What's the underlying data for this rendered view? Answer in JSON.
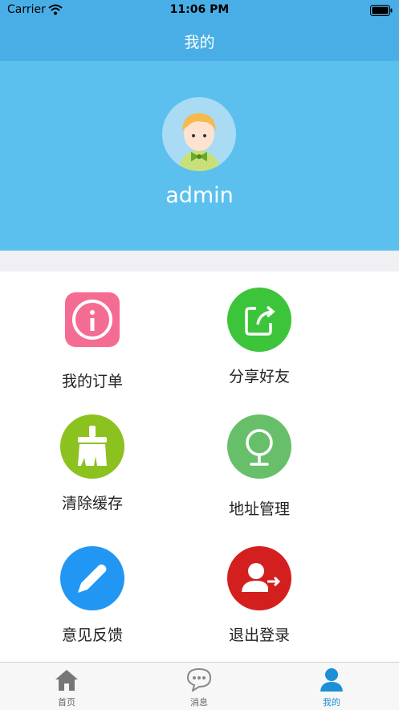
{
  "status_bar": {
    "carrier": "Carrier",
    "time": "11:06 PM"
  },
  "nav": {
    "title": "我的"
  },
  "profile": {
    "username": "admin"
  },
  "menu": [
    {
      "label": "我的订单",
      "icon": "info-circle-icon",
      "color": "#f56c93"
    },
    {
      "label": "分享好友",
      "icon": "share-icon",
      "color": "#3cc43a"
    },
    {
      "label": "清除缓存",
      "icon": "broom-icon",
      "color": "#8cc21f"
    },
    {
      "label": "地址管理",
      "icon": "location-pin-icon",
      "color": "#68bf6a"
    },
    {
      "label": "意见反馈",
      "icon": "pencil-icon",
      "color": "#2196f3"
    },
    {
      "label": "退出登录",
      "icon": "logout-user-icon",
      "color": "#d41f1f"
    }
  ],
  "tabs": [
    {
      "label": "首页",
      "icon": "home-icon"
    },
    {
      "label": "消息",
      "icon": "chat-icon"
    },
    {
      "label": "我的",
      "icon": "profile-icon",
      "active": true
    }
  ],
  "colors": {
    "header": "#4aaee6",
    "profile_bg": "#5bc0ee",
    "tab_active": "#1d8fd6"
  }
}
